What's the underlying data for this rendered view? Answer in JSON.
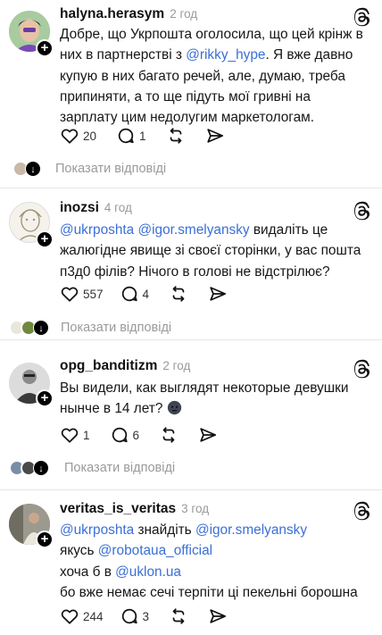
{
  "posts": [
    {
      "username": "halyna.herasym",
      "time": "2 год",
      "text_parts": [
        "Добре, що Укрпошта оголосила, що цей крінж в них в партнерстві з ",
        "@rikky_hype",
        ". Я вже давно купую в них багато речей, але, думаю, треба припиняти, а то ще підуть мої гривні на зарплату цим недолугим маркетологам."
      ],
      "likes": "20",
      "comments": "1",
      "reposts": "",
      "show_replies": "Показати відповіді"
    },
    {
      "username": "inozsi",
      "time": "4 год",
      "text_parts": [
        "@ukrposhta",
        " ",
        "@igor.smelyansky",
        "  видаліть це жалюгідне явище зі своєї сторінки, у вас пошта п3д0 філів? Нічого в голові не відстрілює?"
      ],
      "likes": "557",
      "comments": "4",
      "show_replies": "Показати відповіді"
    },
    {
      "username": "opg_banditizm",
      "time": "2 год",
      "text": "Вы видели, как выглядят некоторые девушки нынче в 14 лет?",
      "likes": "1",
      "comments": "6",
      "show_replies": "Показати відповіді"
    },
    {
      "username": "veritas_is_veritas",
      "time": "3 год",
      "line1": [
        "@ukrposhta",
        " знайдіть ",
        "@igor.smelyansky"
      ],
      "line2": [
        "якусь ",
        "@robotaua_official"
      ],
      "line3": [
        "хоча б в ",
        "@uklon.ua"
      ],
      "line4": "бо вже немає сечі терпіти ці пекельні борошна",
      "likes": "244",
      "comments": "3"
    }
  ],
  "icons": {
    "like": "heart-icon",
    "comment": "comment-icon",
    "repost": "repost-icon",
    "share": "send-icon",
    "threads": "threads-logo-icon",
    "follow": "plus-icon",
    "expand": "arrow-down-icon"
  },
  "colors": {
    "mention": "#3b6fd6",
    "muted": "#9a9a9a",
    "text": "#161616"
  }
}
